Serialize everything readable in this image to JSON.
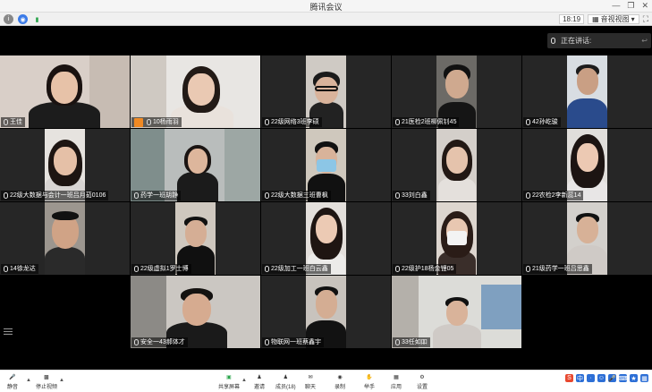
{
  "window": {
    "title": "腾讯会议"
  },
  "toolbar": {
    "time": "18:19",
    "view_label": "音视视图"
  },
  "speaking": {
    "label": "正在讲话:"
  },
  "tiles": [
    {
      "name": "王佳",
      "host": false
    },
    {
      "name": "10杨雨羽",
      "host": true
    },
    {
      "name": "22级网络3班李硕",
      "host": false
    },
    {
      "name": "21医检2班柳佩钊45",
      "host": false
    },
    {
      "name": "42孙屹骏",
      "host": false
    },
    {
      "name": "22级大数据与会计一班吕月茹0106",
      "host": false
    },
    {
      "name": "药学一班胡静",
      "host": false
    },
    {
      "name": "22级大数据三班曹枫",
      "host": false
    },
    {
      "name": "33刘白鑫",
      "host": false
    },
    {
      "name": "22农检2李新蕊14",
      "host": false
    },
    {
      "name": "14徐龙达",
      "host": false
    },
    {
      "name": "22级虚拟1罗士博",
      "host": false
    },
    {
      "name": "22级加工一班白云鑫",
      "host": false
    },
    {
      "name": "22级护18杨金锂05",
      "host": false
    },
    {
      "name": "21级药学一班吕思鑫",
      "host": false
    },
    {
      "name": "安全一43郝体才",
      "host": false
    },
    {
      "name": "物联网一班蔡鑫宇",
      "host": false
    },
    {
      "name": "33任如吅",
      "host": false
    }
  ],
  "bottom": {
    "mute": "静音",
    "video": "停止视频",
    "share": "共享屏幕",
    "invite": "邀请",
    "members": "成员(18)",
    "chat": "聊天",
    "record": "录制",
    "raise": "举手",
    "apps": "应用",
    "settings": "设置"
  },
  "colors": {
    "titlebar": "#f5f5f5",
    "tile_bg": "#262626",
    "host_badge": "#f08a24",
    "tray_brand": "#e8482f"
  }
}
